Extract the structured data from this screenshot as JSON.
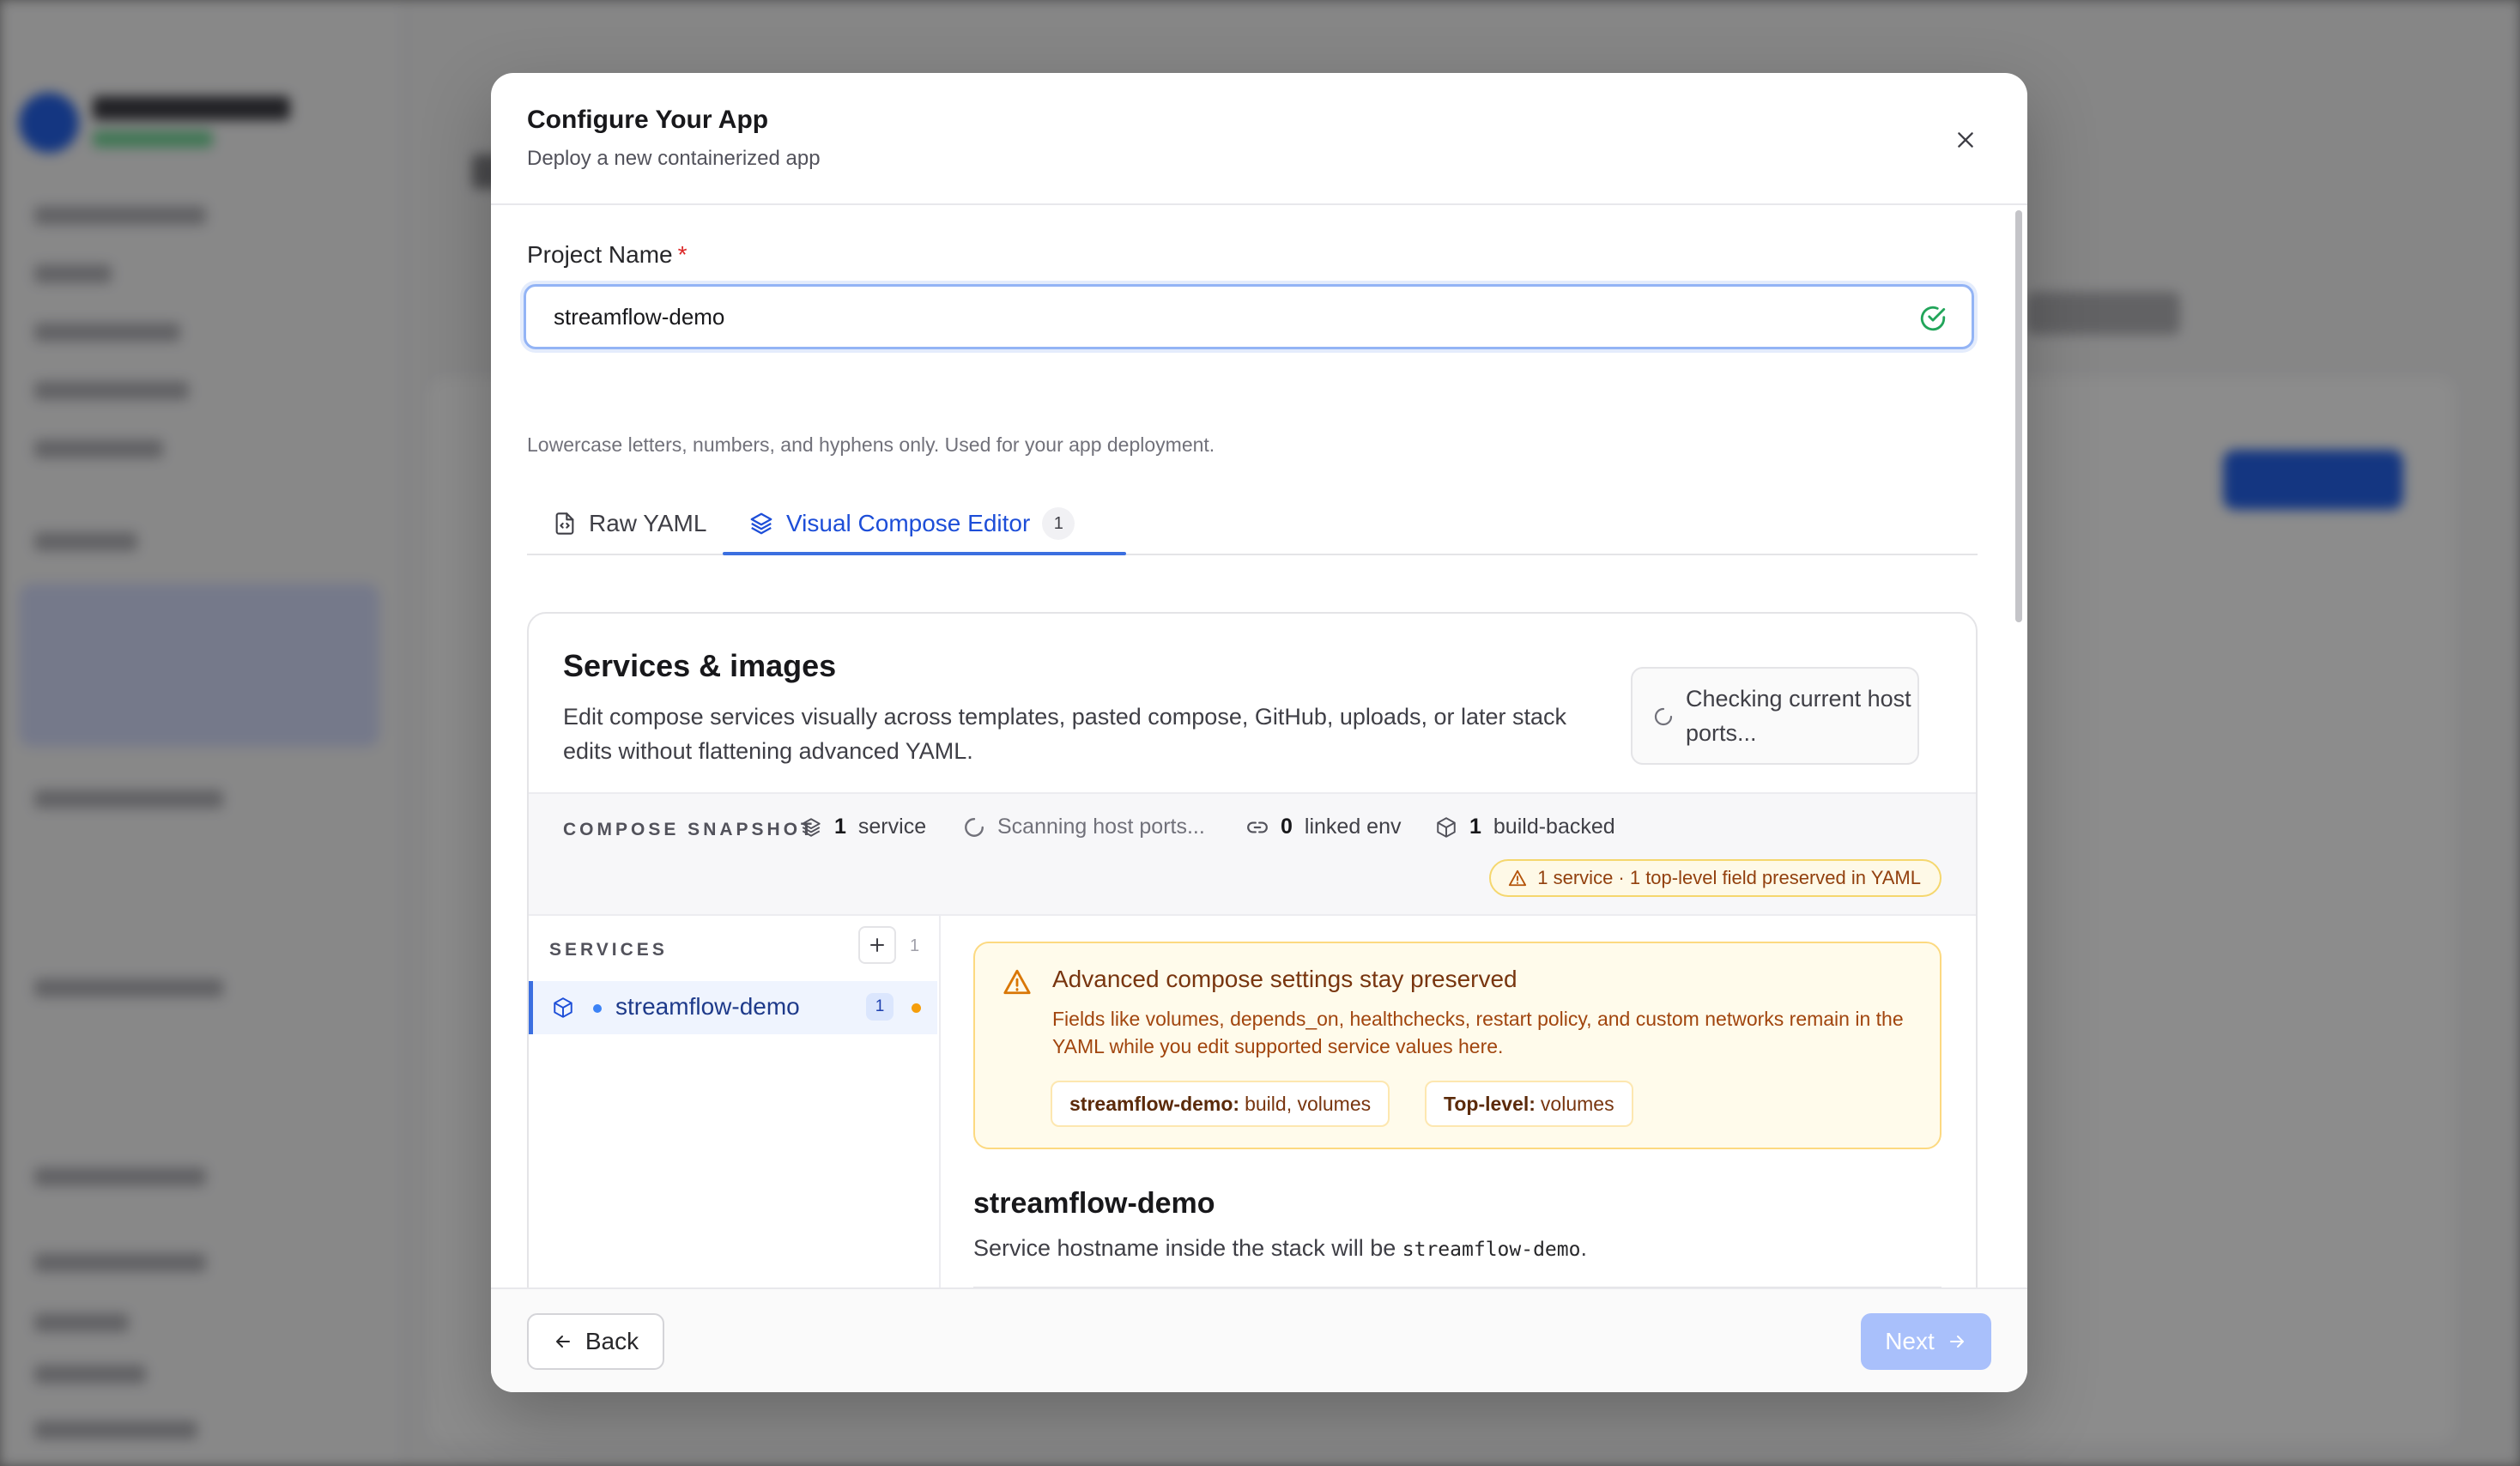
{
  "modal": {
    "title": "Configure Your App",
    "subtitle": "Deploy a new containerized app"
  },
  "project": {
    "label": "Project Name",
    "required_mark": "*",
    "value": "streamflow-demo",
    "helper": "Lowercase letters, numbers, and hyphens only. Used for your app deployment."
  },
  "tabs": [
    {
      "label": "Raw YAML",
      "icon": "file-code-icon",
      "active": false
    },
    {
      "label": "Visual Compose Editor",
      "icon": "layers-icon",
      "active": true,
      "badge": "1"
    }
  ],
  "services_card": {
    "title": "Services & images",
    "description": "Edit compose services visually across templates, pasted compose, GitHub, uploads, or later stack edits without flattening advanced YAML.",
    "status": "Checking current host ports..."
  },
  "snapshot": {
    "label": "COMPOSE SNAPSHOT",
    "service_count": "1",
    "service_label": "service",
    "scanning": "Scanning host ports...",
    "linked_env_count": "0",
    "linked_env_label": "linked env",
    "build_count": "1",
    "build_label": "build-backed",
    "warning": "1 service · 1 top-level field preserved in YAML"
  },
  "services": {
    "label": "SERVICES",
    "count": "1",
    "items": [
      {
        "name": "streamflow-demo",
        "badge": "1"
      }
    ]
  },
  "advanced": {
    "title": "Advanced compose settings stay preserved",
    "description": "Fields like volumes, depends_on, healthchecks, restart policy, and custom networks remain in the YAML while you edit supported service values here.",
    "chips": [
      {
        "key": "streamflow-demo:",
        "value": "build, volumes"
      },
      {
        "key": "Top-level:",
        "value": "volumes"
      }
    ]
  },
  "service_detail": {
    "name": "streamflow-demo",
    "hint_prefix": "Service hostname inside the stack will be",
    "hostname": "streamflow-demo",
    "hint_suffix": "."
  },
  "footer": {
    "back_label": "Back",
    "next_label": "Next"
  },
  "colors": {
    "accent": "#3b6fe0",
    "warning_bg": "#fffbeb",
    "warning_border": "#fcd980",
    "success": "#22a55a"
  }
}
